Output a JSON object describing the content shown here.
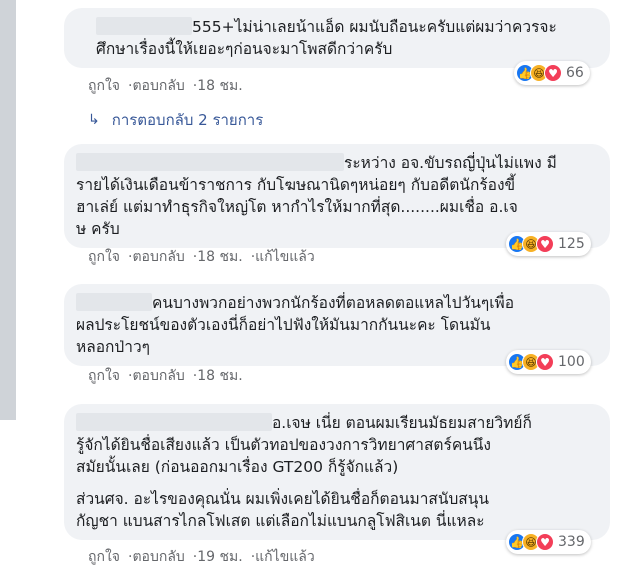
{
  "comments": [
    {
      "text_line1": "555+ไม่น่าเลยน้าแอ็ด ผมนับถือนะครับแต่ผมว่าควรจะ",
      "text_line2": "ศึกษาเรื่องนี้ให้เยอะๆก่อนจะมาโพสดีกว่าครับ",
      "like": "ถูกใจ",
      "reply": "ตอบกลับ",
      "time": "18 ชม.",
      "reaction_count": "66"
    },
    {
      "text_line1": "ระหว่าง อจ.ขับรถญี่ปุ่นไม่แพง มี",
      "text_line2": "รายได้เงินเดือนข้าราชการ กับโฆษณานิดๆหน่อยๆ กับอดีตนักร้องขี้",
      "text_line3": "ฮาเล่ย์ แต่มาทำธุรกิจใหญ่โต หากำไรให้มากที่สุด........ผมเชื่อ อ.เจ",
      "text_line4": "ษ ครับ",
      "like": "ถูกใจ",
      "reply": "ตอบกลับ",
      "time": "18 ชม.",
      "edited": "แก้ไขแล้ว",
      "reaction_count": "125"
    },
    {
      "text_line1": "คนบางพวกอย่างพวกนักร้องที่ตอหลดตอแหลไปวันๆเพื่อ",
      "text_line2": "ผลประโยชน์ของตัวเองนี่ก็อย่าไปฟังให้มันมากกันนะคะ โดนมัน",
      "text_line3": "หลอกป่าวๆ",
      "like": "ถูกใจ",
      "reply": "ตอบกลับ",
      "time": "18 ชม.",
      "reaction_count": "100"
    },
    {
      "text_line1": "อ.เจษ เนี่ย ตอนผมเรียนมัธยมสายวิทย์ก็",
      "text_line2": "รู้จักได้ยินชื่อเสียงแล้ว เป็นตัวทอปของวงการวิทยาศาสตร์คนนึง",
      "text_line3": "สมัยนั้นเลย (ก่อนออกมาเรื่อง GT200 ก็รู้จักแล้ว)",
      "text_line4": "ส่วนศจ. อะไรของคุณนั่น ผมเพิ่งเคยได้ยินชื่อก็ตอนมาสนับสนุน",
      "text_line5": "กัญชา แบนสารไกลโฟเสต แต่เลือกไม่แบนกลูโฟสิเนต นี่แหละ",
      "like": "ถูกใจ",
      "reply": "ตอบกลับ",
      "time": "19 ชม.",
      "edited": "แก้ไขแล้ว",
      "reaction_count": "339"
    }
  ],
  "replies_link": "การตอบกลับ 2 รายการ",
  "separator": "·",
  "icons": {
    "reactions": [
      "like-icon",
      "haha-icon",
      "love-icon"
    ],
    "reply_arrow": "reply-arrow-icon"
  }
}
